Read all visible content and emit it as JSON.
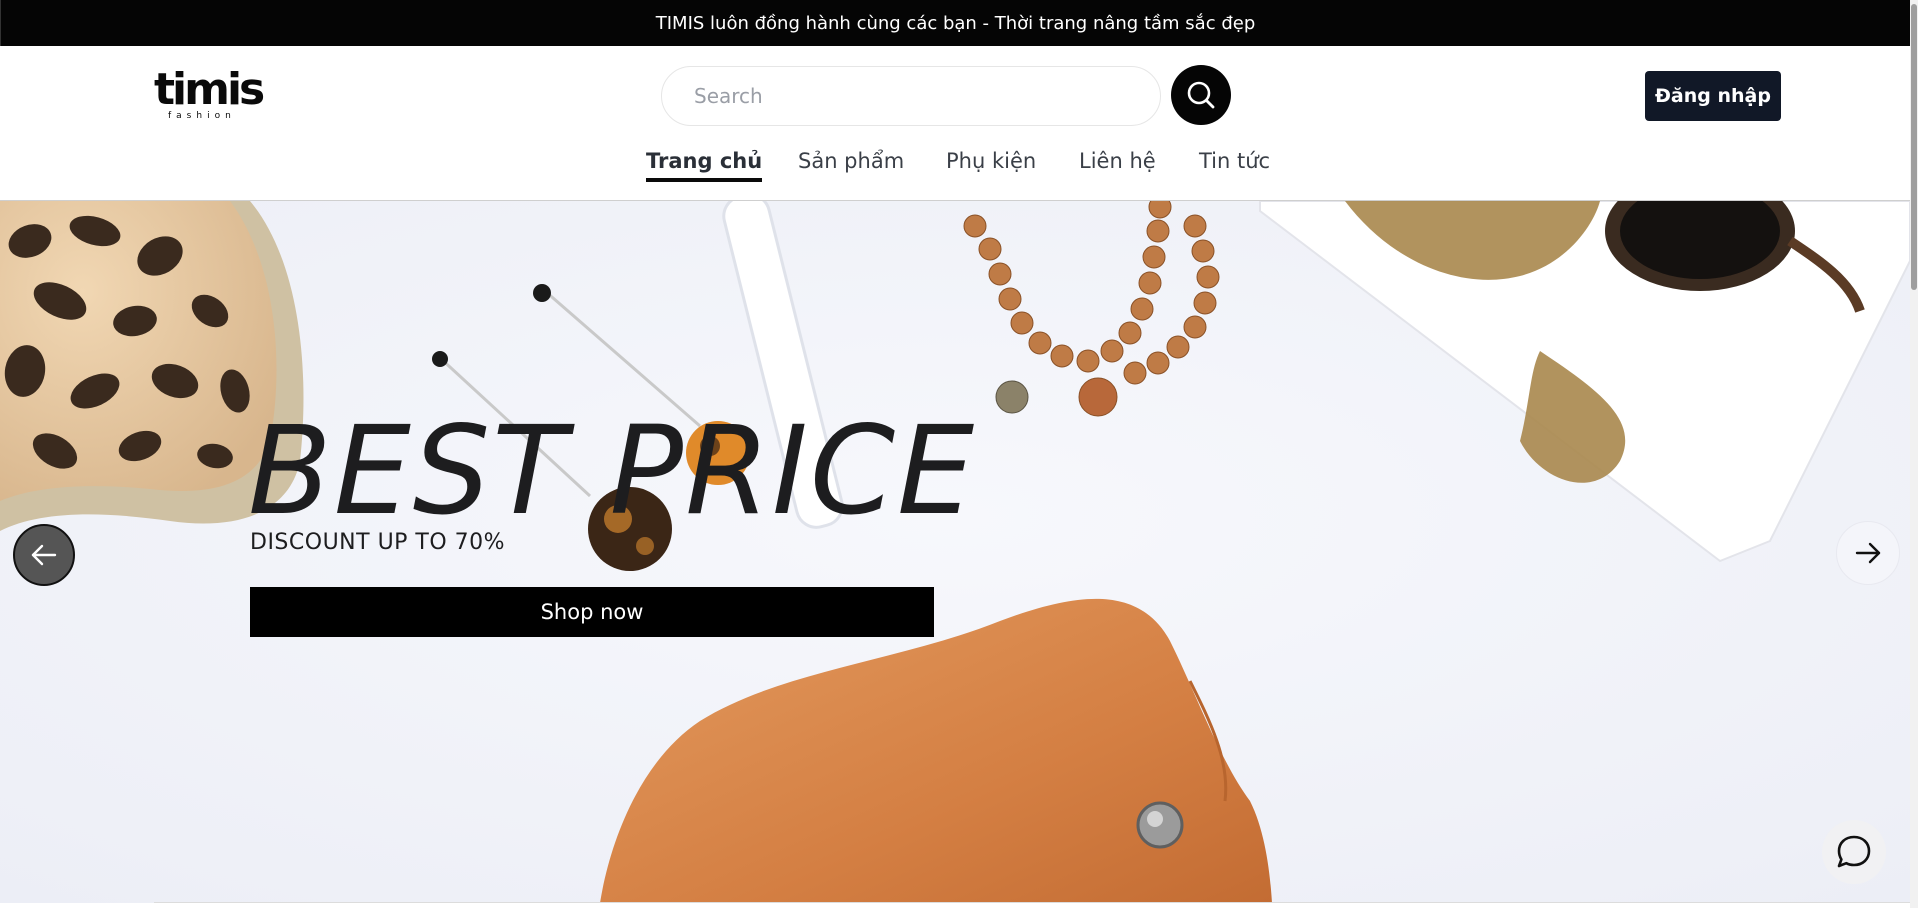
{
  "announcement": {
    "text": "TIMIS luôn đồng hành cùng các bạn - Thời trang nâng tầm sắc đẹp"
  },
  "header": {
    "logo": {
      "word": "timis",
      "sub": "fashion"
    },
    "search": {
      "placeholder": "Search",
      "icon": "search-icon"
    },
    "login_label": "Đăng nhập"
  },
  "nav": {
    "items": [
      {
        "label": "Trang chủ",
        "active": true
      },
      {
        "label": "Sản phẩm",
        "active": false
      },
      {
        "label": "Phụ kiện",
        "active": false
      },
      {
        "label": "Liên hệ",
        "active": false
      },
      {
        "label": "Tin tức",
        "active": false
      }
    ]
  },
  "hero": {
    "title": "BEST PRICE",
    "subtitle": "DISCOUNT UP TO 70%",
    "cta_label": "Shop now",
    "prev_icon": "arrow-left-icon",
    "next_icon": "arrow-right-icon"
  },
  "chat": {
    "icon": "chat-bubble-icon"
  },
  "colors": {
    "announcement_bg": "#050505",
    "login_bg": "#111827",
    "hero_bg": "#f2f3f9",
    "cta_bg": "#000000",
    "leather": "#d9844a"
  }
}
